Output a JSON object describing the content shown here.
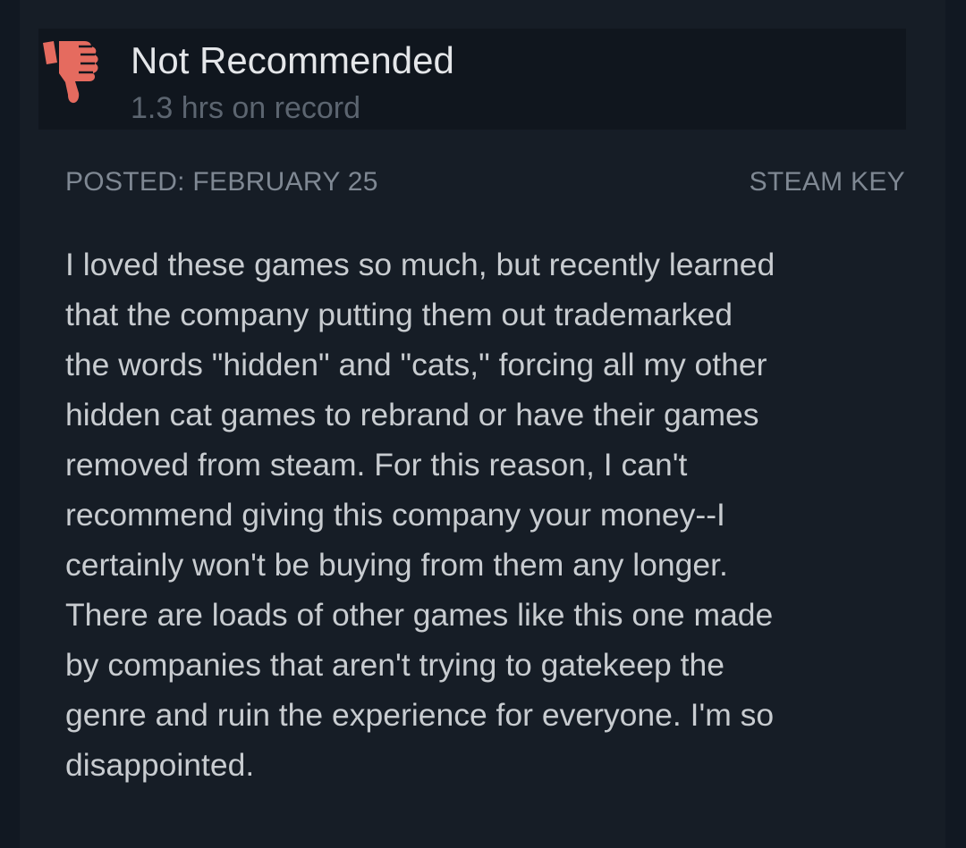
{
  "review": {
    "verdict": "Not Recommended",
    "hours": "1.3 hrs on record",
    "posted": "POSTED: FEBRUARY 25",
    "source": "STEAM KEY",
    "thumb_icon": "thumbs-down-icon",
    "thumb_color": "#e56b5f",
    "lines": [
      "I loved these games so much, but recently learned",
      "that the company putting them out trademarked",
      "the words \"hidden\" and \"cats,\" forcing all my other",
      "hidden cat games to rebrand or have their games",
      "removed from steam. For this reason, I can't",
      "recommend giving this company your money--I",
      "certainly won't be buying from them any longer.",
      "There are loads of other games like this one made",
      "by companies that aren't trying to gatekeep the",
      "genre and ruin the experience for everyone. I'm so",
      "disappointed."
    ]
  }
}
